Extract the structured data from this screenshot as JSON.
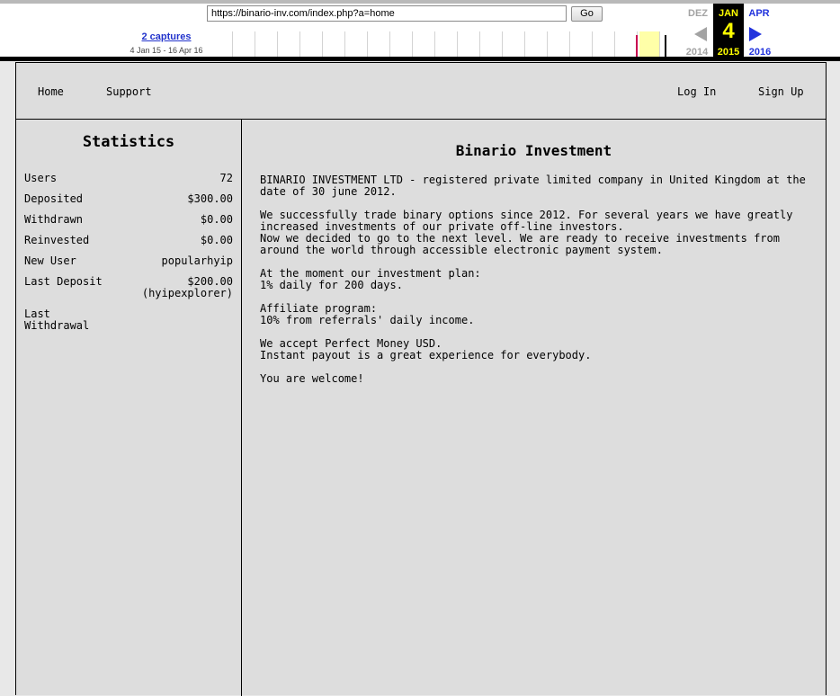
{
  "wayback": {
    "url": "https://binario-inv.com/index.php?a=home",
    "go_label": "Go",
    "captures_label": "2 captures",
    "captures_range": "4 Jan 15 - 16 Apr 16",
    "prev_month": "DEZ",
    "current_month": "JAN",
    "next_month": "APR",
    "prev_year": "2014",
    "current_year": "2015",
    "next_year": "2016",
    "current_day": "4",
    "colors": {
      "current_bg": "#000000",
      "current_text": "#ffff00",
      "link": "#2233cc"
    }
  },
  "nav": {
    "home": "Home",
    "support": "Support",
    "login": "Log In",
    "signup": "Sign Up"
  },
  "sidebar": {
    "title": "Statistics",
    "stats": [
      {
        "label": "Users",
        "value": "72"
      },
      {
        "label": "Deposited",
        "value": "$300.00"
      },
      {
        "label": "Withdrawn",
        "value": "$0.00"
      },
      {
        "label": "Reinvested",
        "value": "$0.00"
      },
      {
        "label": "New User",
        "value": "popularhyip"
      },
      {
        "label": "Last Deposit",
        "value": "$200.00",
        "value2": "(hyipexplorer)"
      },
      {
        "label": "Last Withdrawal",
        "value": ""
      }
    ]
  },
  "content": {
    "title": "Binario Investment",
    "p1": "BINARIO INVESTMENT LTD - registered private limited company in United Kingdom at the date of 30 june 2012.",
    "p2a": "We successfully trade binary options since 2012. For several years we have greatly increased investments of our private off-line investors.",
    "p2b": "Now we decided to go to the next level. We are ready to receive investments from around the world through accessible electronic payment system.",
    "p3a": "At the moment our investment plan:",
    "p3b": "1% daily for 200 days.",
    "p4a": "Affiliate program:",
    "p4b": "10% from referrals' daily income.",
    "p5a": "We accept Perfect Money USD.",
    "p5b": "Instant payout is a great experience for everybody.",
    "p6": "You are welcome!"
  }
}
